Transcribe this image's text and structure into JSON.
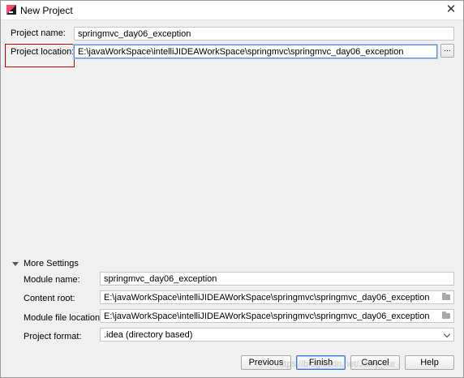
{
  "window": {
    "title": "New Project",
    "close_symbol": "✕"
  },
  "project": {
    "name_label": "Project name:",
    "name_value": "springmvc_day06_exception",
    "location_label": "Project location:",
    "location_value": "E:\\javaWorkSpace\\intelliJIDEAWorkSpace\\springmvc\\springmvc_day06_exception",
    "browse_label": "..."
  },
  "more_settings": {
    "header": "More Settings",
    "module_name_label": "Module name:",
    "module_name_value": "springmvc_day06_exception",
    "content_root_label": "Content root:",
    "content_root_value": "E:\\javaWorkSpace\\intelliJIDEAWorkSpace\\springmvc\\springmvc_day06_exception",
    "module_file_label": "Module file location:",
    "module_file_value": "E:\\javaWorkSpace\\intelliJIDEAWorkSpace\\springmvc\\springmvc_day06_exception",
    "format_label": "Project format:",
    "format_value": ".idea (directory based)"
  },
  "buttons": {
    "previous": "Previous",
    "finish": "Finish",
    "cancel": "Cancel",
    "help": "Help"
  },
  "watermark": "https://blog.csdn.net/Jerry_ike",
  "colors": {
    "highlight_box": "#c00000",
    "focus_border": "#5a93d8"
  }
}
